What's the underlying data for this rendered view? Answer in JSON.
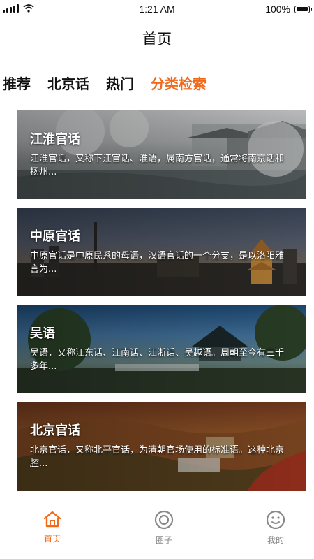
{
  "status": {
    "time": "1:21 AM",
    "battery": "100%",
    "battery_level": 1.0
  },
  "header": {
    "title": "首页"
  },
  "tabs": [
    {
      "label": "推荐",
      "active": false
    },
    {
      "label": "北京话",
      "active": false
    },
    {
      "label": "热门",
      "active": false
    },
    {
      "label": "分类检索",
      "active": true
    }
  ],
  "accent_color": "#f06a1c",
  "cards": [
    {
      "title": "江淮官话",
      "desc": "江淮官话，又称下江官话、淮语，属南方官话，通常将南京话和扬州..."
    },
    {
      "title": "中原官话",
      "desc": "中原官话是中原民系的母语，汉语官话的一个分支，是以洛阳雅言为..."
    },
    {
      "title": "吴语",
      "desc": "吴语，又称江东话、江南话、江浙话、吴越语。周朝至今有三千多年..."
    },
    {
      "title": "北京官话",
      "desc": "北京官话，又称北平官话，为清朝官场使用的标准语。这种北京腔..."
    }
  ],
  "tabbar": {
    "home": {
      "label": "首页",
      "icon": "home-icon"
    },
    "circle": {
      "label": "圈子",
      "icon": "circle-icon"
    },
    "me": {
      "label": "我的",
      "icon": "smiley-icon"
    }
  }
}
